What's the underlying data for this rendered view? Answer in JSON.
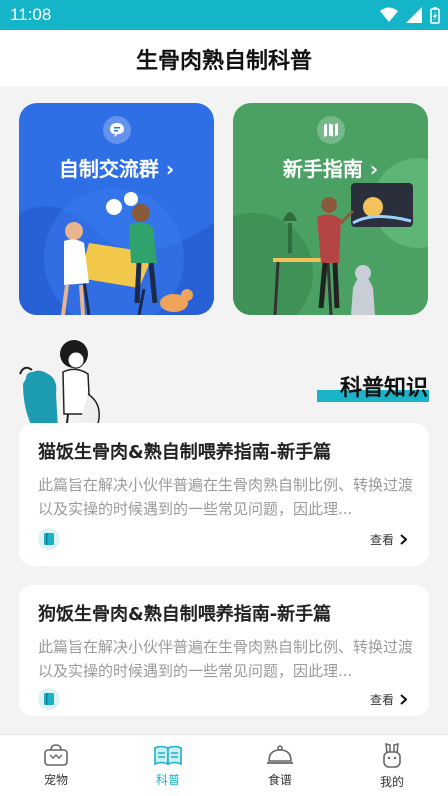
{
  "status": {
    "time": "11:08"
  },
  "header": {
    "title": "生骨肉熟自制科普"
  },
  "cards": [
    {
      "label": "自制交流群 ›",
      "icon": "chat-bubble-icon"
    },
    {
      "label": "新手指南 ›",
      "icon": "map-icon"
    }
  ],
  "section": {
    "title": "科普知识"
  },
  "articles": [
    {
      "title": "猫饭生骨肉&熟自制喂养指南-新手篇",
      "summary": "此篇旨在解决小伙伴普遍在生骨肉熟自制比例、转换过渡以及实操的时候遇到的一些常见问题，因此理...",
      "action": "查看"
    },
    {
      "title": "狗饭生骨肉&熟自制喂养指南-新手篇",
      "summary": "此篇旨在解决小伙伴普遍在生骨肉熟自制比例、转换过渡以及实操的时候遇到的一些常见问题，因此理...",
      "action": "查看"
    }
  ],
  "tabs": [
    {
      "label": "宠物",
      "icon": "pet-bag-icon"
    },
    {
      "label": "科普",
      "icon": "book-icon"
    },
    {
      "label": "食谱",
      "icon": "food-cloche-icon"
    },
    {
      "label": "我的",
      "icon": "rabbit-profile-icon"
    }
  ],
  "colors": {
    "accent": "#19b3ca",
    "blue_card": "#2f6fe6",
    "green_card": "#4aa163"
  }
}
